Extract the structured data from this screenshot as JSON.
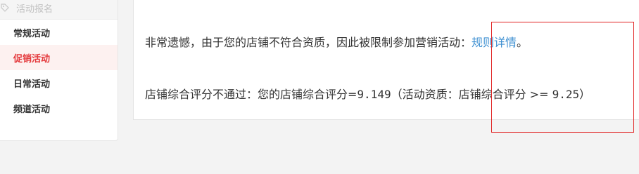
{
  "sidebar": {
    "header_label": "活动报名",
    "header_icon": "tag-icon",
    "active_color": "#e4393c",
    "items": [
      {
        "label": "常规活动"
      },
      {
        "label": "促销活动"
      },
      {
        "label": "日常活动"
      },
      {
        "label": "频道活动"
      }
    ]
  },
  "main": {
    "message": {
      "text": "非常遗憾，由于您的店铺不符合资质，因此被限制参加营销活动：",
      "link_label": "规则详情",
      "suffix": "。",
      "link_color": "#3d8fd1"
    },
    "detail": {
      "prefix": "店铺综合评分不通过：您的店铺综合评分=",
      "score": "9.149",
      "qualification": "（活动资质：店铺综合评分 >= ",
      "threshold": "9.25",
      "close": "）"
    }
  },
  "annotation": {
    "box_color": "#e02020"
  }
}
